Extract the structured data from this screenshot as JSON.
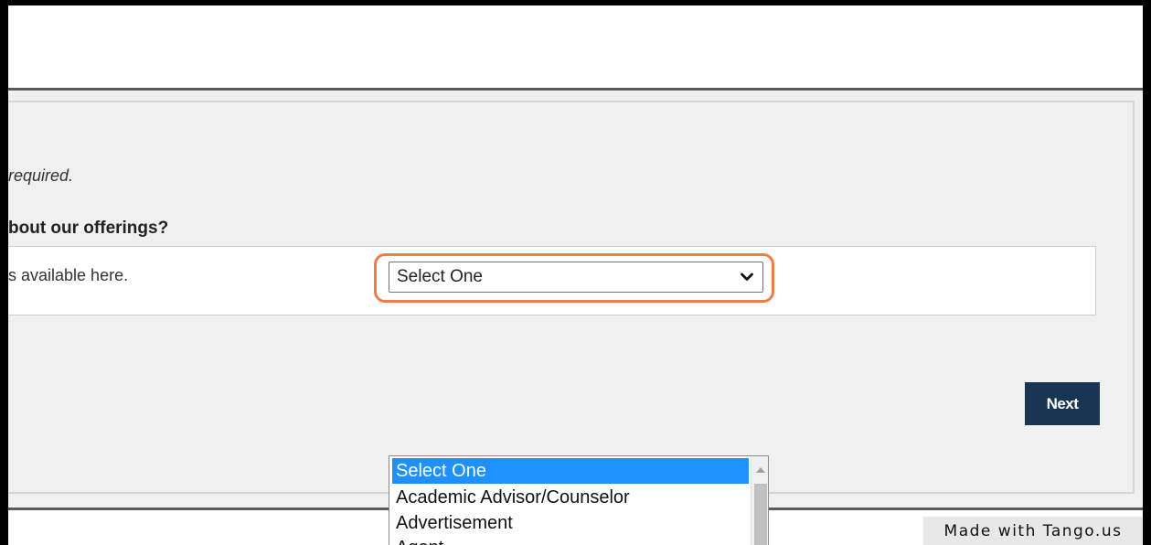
{
  "form": {
    "required_note": "required.",
    "question_heading": "bout our offerings?",
    "field_label": "s available here.",
    "select_value": "Select One",
    "next_label": "Next"
  },
  "dropdown": {
    "options": [
      {
        "label": "Select One",
        "selected": true
      },
      {
        "label": "Academic Advisor/Counselor",
        "selected": false
      },
      {
        "label": "Advertisement",
        "selected": false
      },
      {
        "label": "Agent",
        "selected": false
      }
    ]
  },
  "watermark": {
    "text": "Made with Tango.us"
  },
  "colors": {
    "highlight": "#f07d46",
    "button": "#183552",
    "selected_option": "#1e90ff"
  },
  "icons": {
    "select_chevron": "chevron-down-icon",
    "scroll_up": "scroll-up-arrow-icon"
  }
}
